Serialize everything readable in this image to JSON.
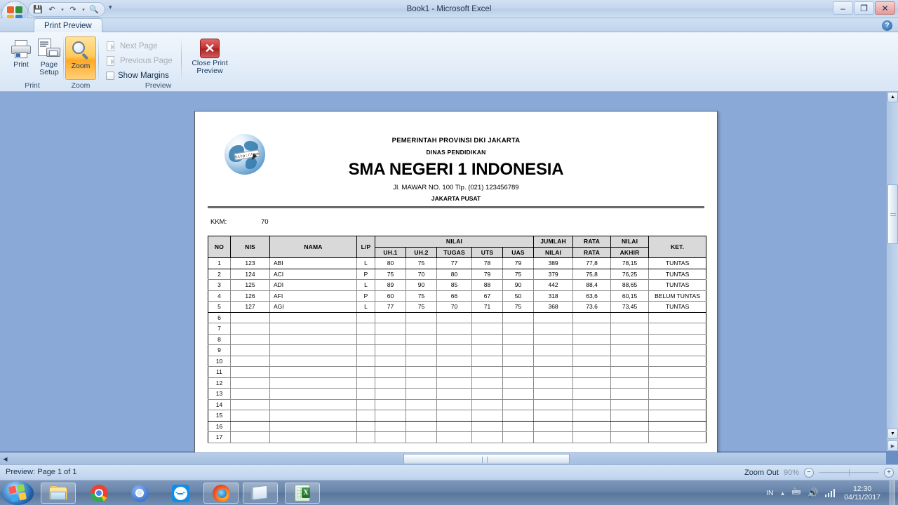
{
  "window": {
    "title": "Book1 - Microsoft Excel",
    "minimize": "–",
    "restore": "❐",
    "close": "✕",
    "help": "?"
  },
  "quick_access": {
    "save": "💾",
    "undo": "↶",
    "redo": "↷",
    "print_preview": "🔍",
    "dropdown": "▾",
    "caret": "▾"
  },
  "ribbon": {
    "tab": "Print Preview",
    "groups": [
      {
        "name": "Print",
        "label": "Print"
      },
      {
        "name": "Zoom",
        "label": "Zoom"
      },
      {
        "name": "Preview",
        "label": "Preview"
      }
    ],
    "print_button": "Print",
    "page_setup_button": "Page\nSetup",
    "page_setup_line1": "Page",
    "page_setup_line2": "Setup",
    "zoom_button": "Zoom",
    "next_page": "Next Page",
    "previous_page": "Previous Page",
    "show_margins": "Show Margins",
    "close_preview_line1": "Close Print",
    "close_preview_line2": "Preview",
    "close_x": "✕"
  },
  "document": {
    "logo_text": "http://www",
    "line1": "PEMERINTAH PROVINSI DKI JAKARTA",
    "line2": "DINAS PENDIDIKAN",
    "school": "SMA NEGERI 1 INDONESIA",
    "address": "Jl. MAWAR NO. 100 Tlp. (021) 123456789",
    "city": "JAKARTA PUSAT",
    "kkm_label": "KKM:",
    "kkm_value": "70"
  },
  "table": {
    "headers_row1": [
      "NO",
      "NIS",
      "NAMA",
      "L/P",
      "NILAI",
      "JUMLAH",
      "RATA",
      "NILAI",
      "KET."
    ],
    "group_header": "NILAI",
    "sub_headers": [
      "UH.1",
      "UH.2",
      "TUGAS",
      "UTS",
      "UAS"
    ],
    "col_no": "NO",
    "col_nis": "NIS",
    "col_nama": "NAMA",
    "col_lp": "L/P",
    "col_jumlah_1": "JUMLAH",
    "col_jumlah_2": "NILAI",
    "col_rata_1": "RATA",
    "col_rata_2": "RATA",
    "col_akhir_1": "NILAI",
    "col_akhir_2": "AKHIR",
    "col_ket": "KET.",
    "rows": [
      {
        "no": "1",
        "nis": "123",
        "nama": "ABI",
        "lp": "L",
        "uh1": "80",
        "uh2": "75",
        "tugas": "77",
        "uts": "78",
        "uas": "79",
        "jumlah": "389",
        "rata": "77,8",
        "akhir": "78,15",
        "ket": "TUNTAS"
      },
      {
        "no": "2",
        "nis": "124",
        "nama": "ACI",
        "lp": "P",
        "uh1": "75",
        "uh2": "70",
        "tugas": "80",
        "uts": "79",
        "uas": "75",
        "jumlah": "379",
        "rata": "75,8",
        "akhir": "76,25",
        "ket": "TUNTAS"
      },
      {
        "no": "3",
        "nis": "125",
        "nama": "ADI",
        "lp": "L",
        "uh1": "89",
        "uh2": "90",
        "tugas": "85",
        "uts": "88",
        "uas": "90",
        "jumlah": "442",
        "rata": "88,4",
        "akhir": "88,65",
        "ket": "TUNTAS"
      },
      {
        "no": "4",
        "nis": "126",
        "nama": "AFI",
        "lp": "P",
        "uh1": "60",
        "uh2": "75",
        "tugas": "66",
        "uts": "67",
        "uas": "50",
        "jumlah": "318",
        "rata": "63,6",
        "akhir": "60,15",
        "ket": "BELUM TUNTAS"
      },
      {
        "no": "5",
        "nis": "127",
        "nama": "AGI",
        "lp": "L",
        "uh1": "77",
        "uh2": "75",
        "tugas": "70",
        "uts": "71",
        "uas": "75",
        "jumlah": "368",
        "rata": "73,6",
        "akhir": "73,45",
        "ket": "TUNTAS"
      },
      {
        "no": "6",
        "nis": "",
        "nama": "",
        "lp": "",
        "uh1": "",
        "uh2": "",
        "tugas": "",
        "uts": "",
        "uas": "",
        "jumlah": "",
        "rata": "",
        "akhir": "",
        "ket": ""
      },
      {
        "no": "7",
        "nis": "",
        "nama": "",
        "lp": "",
        "uh1": "",
        "uh2": "",
        "tugas": "",
        "uts": "",
        "uas": "",
        "jumlah": "",
        "rata": "",
        "akhir": "",
        "ket": ""
      },
      {
        "no": "8",
        "nis": "",
        "nama": "",
        "lp": "",
        "uh1": "",
        "uh2": "",
        "tugas": "",
        "uts": "",
        "uas": "",
        "jumlah": "",
        "rata": "",
        "akhir": "",
        "ket": ""
      },
      {
        "no": "9",
        "nis": "",
        "nama": "",
        "lp": "",
        "uh1": "",
        "uh2": "",
        "tugas": "",
        "uts": "",
        "uas": "",
        "jumlah": "",
        "rata": "",
        "akhir": "",
        "ket": ""
      },
      {
        "no": "10",
        "nis": "",
        "nama": "",
        "lp": "",
        "uh1": "",
        "uh2": "",
        "tugas": "",
        "uts": "",
        "uas": "",
        "jumlah": "",
        "rata": "",
        "akhir": "",
        "ket": ""
      },
      {
        "no": "11",
        "nis": "",
        "nama": "",
        "lp": "",
        "uh1": "",
        "uh2": "",
        "tugas": "",
        "uts": "",
        "uas": "",
        "jumlah": "",
        "rata": "",
        "akhir": "",
        "ket": ""
      },
      {
        "no": "12",
        "nis": "",
        "nama": "",
        "lp": "",
        "uh1": "",
        "uh2": "",
        "tugas": "",
        "uts": "",
        "uas": "",
        "jumlah": "",
        "rata": "",
        "akhir": "",
        "ket": ""
      },
      {
        "no": "13",
        "nis": "",
        "nama": "",
        "lp": "",
        "uh1": "",
        "uh2": "",
        "tugas": "",
        "uts": "",
        "uas": "",
        "jumlah": "",
        "rata": "",
        "akhir": "",
        "ket": ""
      },
      {
        "no": "14",
        "nis": "",
        "nama": "",
        "lp": "",
        "uh1": "",
        "uh2": "",
        "tugas": "",
        "uts": "",
        "uas": "",
        "jumlah": "",
        "rata": "",
        "akhir": "",
        "ket": ""
      },
      {
        "no": "15",
        "nis": "",
        "nama": "",
        "lp": "",
        "uh1": "",
        "uh2": "",
        "tugas": "",
        "uts": "",
        "uas": "",
        "jumlah": "",
        "rata": "",
        "akhir": "",
        "ket": ""
      },
      {
        "no": "16",
        "nis": "",
        "nama": "",
        "lp": "",
        "uh1": "",
        "uh2": "",
        "tugas": "",
        "uts": "",
        "uas": "",
        "jumlah": "",
        "rata": "",
        "akhir": "",
        "ket": ""
      },
      {
        "no": "17",
        "nis": "",
        "nama": "",
        "lp": "",
        "uh1": "",
        "uh2": "",
        "tugas": "",
        "uts": "",
        "uas": "",
        "jumlah": "",
        "rata": "",
        "akhir": "",
        "ket": ""
      }
    ],
    "thick_after_rows": [
      1,
      5,
      15
    ]
  },
  "status_bar": {
    "preview_text": "Preview: Page 1 of 1",
    "zoom_out_label": "Zoom Out",
    "zoom_percent": "90%",
    "minus": "−",
    "plus": "+"
  },
  "scrollbars": {
    "up_arrow": "▲",
    "down_arrow": "▼",
    "left_arrow": "◀",
    "right_arrow": "▶"
  },
  "taskbar": {
    "items": [
      {
        "name": "start-button",
        "icon": "windows-orb-icon"
      },
      {
        "name": "taskbar-explorer",
        "icon": "folder-icon"
      },
      {
        "name": "taskbar-chrome",
        "icon": "chrome-icon"
      },
      {
        "name": "taskbar-chromium",
        "icon": "chromium-icon"
      },
      {
        "name": "taskbar-teamviewer",
        "icon": "teamviewer-icon"
      },
      {
        "name": "taskbar-firefox",
        "icon": "firefox-icon"
      },
      {
        "name": "taskbar-notepad",
        "icon": "notepad-icon"
      },
      {
        "name": "taskbar-excel",
        "icon": "excel-icon"
      }
    ],
    "tray": {
      "language": "IN",
      "show_hidden": "▲",
      "action_center": "🖮",
      "volume": "🔊",
      "network": "network-icon",
      "time": "12:30",
      "date": "04/11/2017"
    }
  }
}
